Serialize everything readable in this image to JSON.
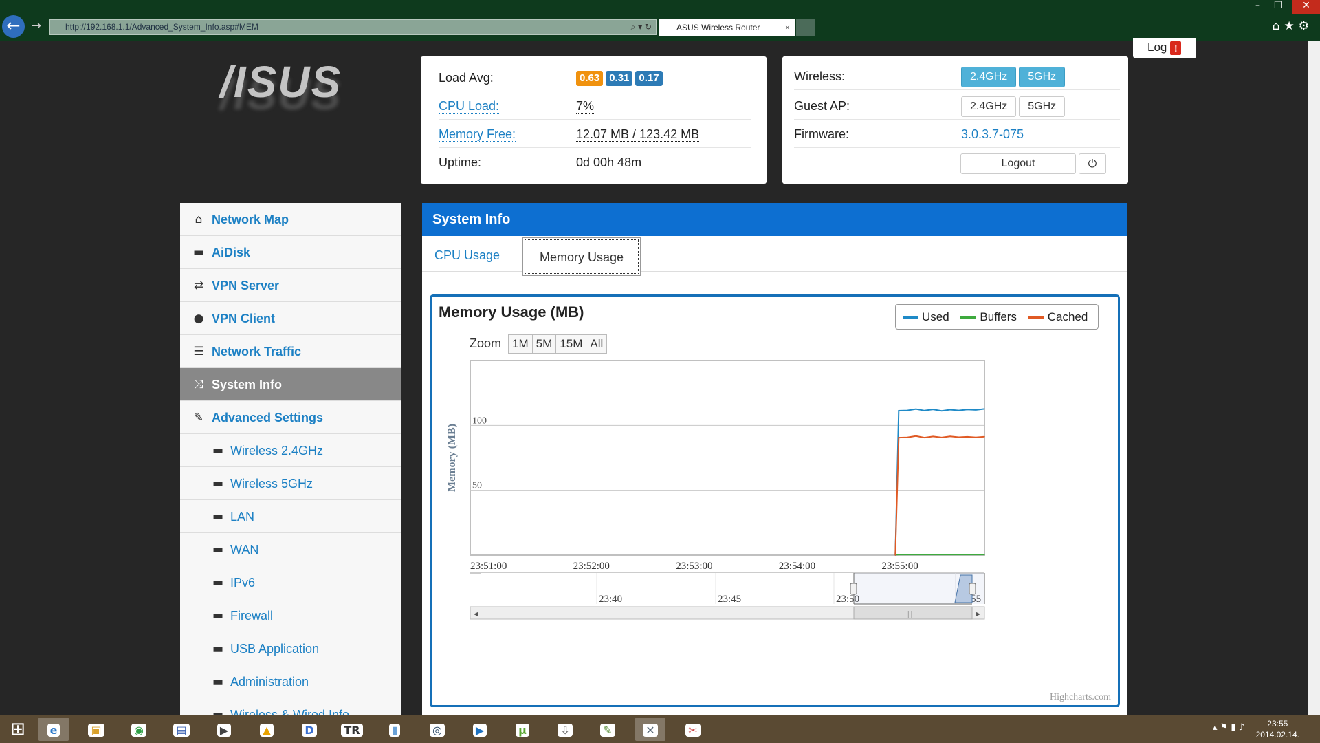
{
  "browser": {
    "url": "http://192.168.1.1/Advanced_System_Info.asp#MEM",
    "tab_title": "ASUS Wireless Router",
    "tab_close": "×",
    "nav_icons": "⌕ ▾ ↻",
    "toolbar_icons": "⌂★⚙"
  },
  "header": {
    "logo": "/ISUS",
    "log_label": "Log",
    "log_alert": "!"
  },
  "status": {
    "load_avg_label": "Load Avg:",
    "load_avg": [
      "0.63",
      "0.31",
      "0.17"
    ],
    "load_colors": [
      "#f0920f",
      "#2d7bb6",
      "#2d7bb6"
    ],
    "cpu_label": "CPU Load:",
    "cpu_value": "7%",
    "mem_label": "Memory Free:",
    "mem_value": "12.07 MB / 123.42 MB",
    "uptime_label": "Uptime:",
    "uptime_value": "0d 00h 48m"
  },
  "wireless": {
    "wireless_label": "Wireless:",
    "guest_label": "Guest AP:",
    "band_24": "2.4GHz",
    "band_5": "5GHz",
    "firmware_label": "Firmware:",
    "firmware_value": "3.0.3.7-075",
    "logout": "Logout"
  },
  "sidebar": {
    "items": [
      {
        "label": "Network Map",
        "icon": "home-icon",
        "glyph": "⌂"
      },
      {
        "label": "AiDisk",
        "icon": "disk-icon",
        "glyph": "▬"
      },
      {
        "label": "VPN Server",
        "icon": "vpn-server-icon",
        "glyph": "⇄"
      },
      {
        "label": "VPN Client",
        "icon": "globe-icon",
        "glyph": "●"
      },
      {
        "label": "Network Traffic",
        "icon": "list-icon",
        "glyph": "☰"
      },
      {
        "label": "System Info",
        "icon": "shuffle-icon",
        "glyph": "⤨"
      },
      {
        "label": "Advanced Settings",
        "icon": "wrench-icon",
        "glyph": "✎"
      }
    ],
    "sub_items": [
      "Wireless 2.4GHz",
      "Wireless 5GHz",
      "LAN",
      "WAN",
      "IPv6",
      "Firewall",
      "USB Application",
      "Administration",
      "Wireless & Wired Info"
    ]
  },
  "main": {
    "title": "System Info",
    "tabs": [
      "CPU Usage",
      "Memory Usage"
    ],
    "zoom_label": "Zoom",
    "zoom_options": [
      "1M",
      "5M",
      "15M",
      "All"
    ],
    "watermark": "Highcharts.com"
  },
  "chart_data": {
    "type": "line",
    "title": "Memory Usage (MB)",
    "ylabel": "Memory (MB)",
    "xlabel": "",
    "ylim": [
      0,
      150
    ],
    "yticks": [
      50,
      100
    ],
    "xticks": [
      "23:51:00",
      "23:52:00",
      "23:53:00",
      "23:54:00",
      "23:55:00"
    ],
    "x_range": [
      "23:51:00",
      "23:56:00"
    ],
    "x": [
      "23:55:08",
      "23:55:10",
      "23:55:15",
      "23:55:20",
      "23:55:25",
      "23:55:30",
      "23:55:35",
      "23:55:40",
      "23:55:45",
      "23:55:50",
      "23:55:55",
      "23:56:00"
    ],
    "series": [
      {
        "name": "Used",
        "color": "#1f8ac7",
        "values": [
          0,
          111.3,
          111.5,
          112.6,
          111.4,
          112.3,
          111.2,
          112.1,
          111.5,
          112.2,
          111.9,
          112.7
        ]
      },
      {
        "name": "Buffers",
        "color": "#3eaa3e",
        "values": [
          0.3,
          0.5,
          0.5,
          0.5,
          0.5,
          0.5,
          0.5,
          0.5,
          0.5,
          0.5,
          0.5,
          0.5
        ]
      },
      {
        "name": "Cached",
        "color": "#e05a24",
        "values": [
          0,
          90.6,
          90.8,
          91.8,
          90.6,
          91.5,
          90.7,
          91.6,
          90.9,
          91.2,
          90.8,
          91.3
        ]
      }
    ],
    "navigator_ticks": [
      "23:40",
      "23:45",
      "23:50",
      "23:55"
    ],
    "grid": true,
    "legend": "top-right"
  },
  "taskbar": {
    "apps": [
      "IE",
      "Explorer",
      "Chrome",
      "Save",
      "Media",
      "VLC",
      "D",
      "TR",
      "Files",
      "Steam",
      "Play",
      "uTorrent",
      "Install",
      "Paint",
      "Tools",
      "Snip"
    ],
    "time": "23:55",
    "date": "2014.02.14."
  }
}
